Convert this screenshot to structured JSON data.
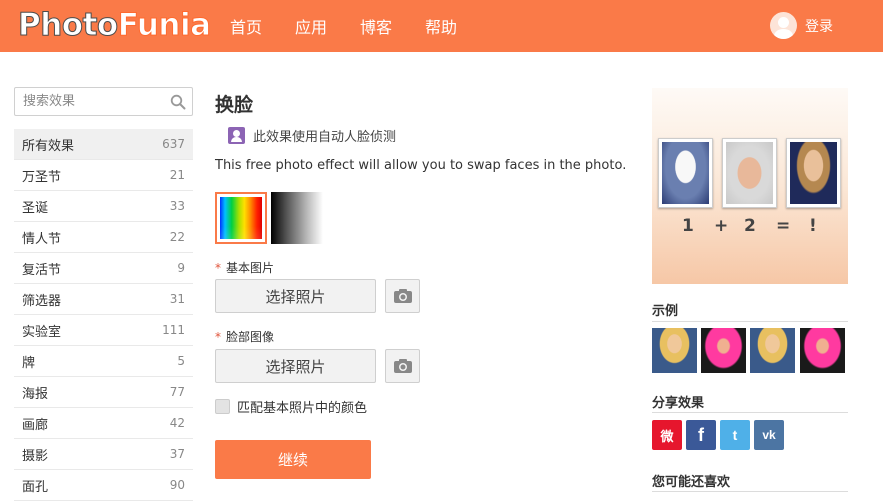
{
  "header": {
    "logo_part1": "Photo",
    "logo_part2": "Funia",
    "nav": [
      "首页",
      "应用",
      "博客",
      "帮助"
    ],
    "login_label": "登录"
  },
  "sidebar": {
    "search_placeholder": "搜索效果",
    "categories": [
      {
        "name": "所有效果",
        "count": "637"
      },
      {
        "name": "万圣节",
        "count": "21"
      },
      {
        "name": "圣诞",
        "count": "33"
      },
      {
        "name": "情人节",
        "count": "22"
      },
      {
        "name": "复活节",
        "count": "9"
      },
      {
        "name": "筛选器",
        "count": "31"
      },
      {
        "name": "实验室",
        "count": "111"
      },
      {
        "name": "牌",
        "count": "5"
      },
      {
        "name": "海报",
        "count": "77"
      },
      {
        "name": "画廊",
        "count": "42"
      },
      {
        "name": "摄影",
        "count": "37"
      },
      {
        "name": "面孔",
        "count": "90"
      }
    ]
  },
  "main": {
    "title": "换脸",
    "face_detection": "此效果使用自动人脸侦测",
    "description": "This free photo effect will allow you to swap faces in the photo.",
    "swatches": [
      "color",
      "black-and-white"
    ],
    "base_image_label": "基本图片",
    "face_image_label": "脸部图像",
    "choose_photo": "选择照片",
    "match_colors_label": "匹配基本照片中的颜色",
    "continue_label": "继续"
  },
  "right": {
    "equation": [
      "1",
      "+",
      "2",
      "=",
      "!"
    ],
    "examples_title": "示例",
    "share_title": "分享效果",
    "share_buttons": [
      "weibo",
      "facebook",
      "twitter",
      "vk"
    ],
    "share_glyphs": {
      "weibo": "微",
      "facebook": "f",
      "twitter": "t",
      "vk": "vk"
    },
    "also_like_title": "您可能还喜欢"
  },
  "colors": {
    "brand": "#fa7a48",
    "face_detect_icon": "#8c64b4"
  }
}
